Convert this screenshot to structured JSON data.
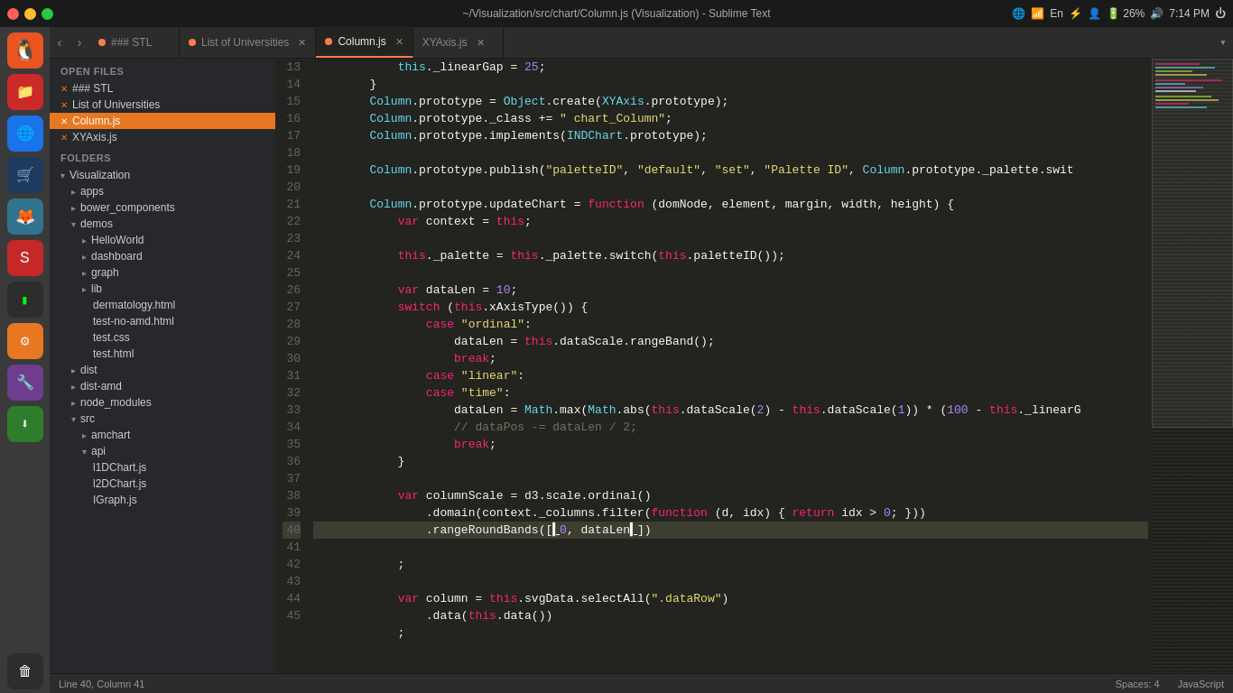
{
  "titlebar": {
    "title": "~/Visualization/src/chart/Column.js (Visualization) - Sublime Text",
    "systray": {
      "time": "7:14 PM",
      "battery": "26%",
      "lang": "En"
    }
  },
  "tabs": [
    {
      "id": "stl",
      "label": "### STL",
      "dot_color": "orange",
      "active": false,
      "closable": false
    },
    {
      "id": "universities",
      "label": "List of Universities",
      "dot_color": "orange",
      "active": false,
      "closable": true
    },
    {
      "id": "column",
      "label": "Column.js",
      "dot_color": "orange",
      "active": true,
      "closable": true
    },
    {
      "id": "xyaxis",
      "label": "XYAxis.js",
      "dot_color": "none",
      "active": false,
      "closable": true
    }
  ],
  "sidebar": {
    "open_files_title": "OPEN FILES",
    "open_files": [
      {
        "label": "### STL",
        "active": false,
        "marked": true
      },
      {
        "label": "List of Universities",
        "active": false,
        "marked": true
      },
      {
        "label": "Column.js",
        "active": true,
        "marked": true
      },
      {
        "label": "XYAxis.js",
        "active": false,
        "marked": true
      }
    ],
    "folders_title": "FOLDERS",
    "folders": [
      {
        "label": "Visualization",
        "level": 0,
        "expanded": true,
        "type": "folder"
      },
      {
        "label": "apps",
        "level": 1,
        "expanded": false,
        "type": "folder"
      },
      {
        "label": "bower_components",
        "level": 1,
        "expanded": false,
        "type": "folder"
      },
      {
        "label": "demos",
        "level": 1,
        "expanded": true,
        "type": "folder"
      },
      {
        "label": "HelloWorld",
        "level": 2,
        "expanded": false,
        "type": "folder"
      },
      {
        "label": "dashboard",
        "level": 2,
        "expanded": false,
        "type": "folder"
      },
      {
        "label": "graph",
        "level": 2,
        "expanded": false,
        "type": "folder"
      },
      {
        "label": "lib",
        "level": 2,
        "expanded": false,
        "type": "folder"
      },
      {
        "label": "dermatology.html",
        "level": 3,
        "type": "file"
      },
      {
        "label": "test-no-amd.html",
        "level": 3,
        "type": "file"
      },
      {
        "label": "test.css",
        "level": 3,
        "type": "file"
      },
      {
        "label": "test.html",
        "level": 3,
        "type": "file"
      },
      {
        "label": "dist",
        "level": 1,
        "expanded": false,
        "type": "folder"
      },
      {
        "label": "dist-amd",
        "level": 1,
        "expanded": false,
        "type": "folder"
      },
      {
        "label": "node_modules",
        "level": 1,
        "expanded": false,
        "type": "folder"
      },
      {
        "label": "src",
        "level": 1,
        "expanded": true,
        "type": "folder"
      },
      {
        "label": "amchart",
        "level": 2,
        "expanded": false,
        "type": "folder"
      },
      {
        "label": "api",
        "level": 2,
        "expanded": true,
        "type": "folder"
      },
      {
        "label": "l1DChart.js",
        "level": 3,
        "type": "file"
      },
      {
        "label": "l2DChart.js",
        "level": 3,
        "type": "file"
      },
      {
        "label": "IGraph.js",
        "level": 3,
        "type": "file"
      }
    ]
  },
  "editor": {
    "lines": [
      {
        "num": 13,
        "code": "            this._linearGap = 25;"
      },
      {
        "num": 14,
        "code": "        }"
      },
      {
        "num": 15,
        "code": "        Column.prototype = Object.create(XYAxis.prototype);"
      },
      {
        "num": 16,
        "code": "        Column.prototype._class += \" chart_Column\";"
      },
      {
        "num": 17,
        "code": "        Column.prototype.implements(INDChart.prototype);"
      },
      {
        "num": 18,
        "code": ""
      },
      {
        "num": 19,
        "code": "        Column.prototype.publish(\"paletteID\", \"default\", \"set\", \"Palette ID\", Column.prototype._palette.swit"
      },
      {
        "num": 20,
        "code": ""
      },
      {
        "num": 21,
        "code": "        Column.prototype.updateChart = function (domNode, element, margin, width, height) {"
      },
      {
        "num": 22,
        "code": "            var context = this;"
      },
      {
        "num": 23,
        "code": ""
      },
      {
        "num": 24,
        "code": "            this._palette = this._palette.switch(this.paletteID());"
      },
      {
        "num": 25,
        "code": ""
      },
      {
        "num": 26,
        "code": "            var dataLen = 10;"
      },
      {
        "num": 27,
        "code": "            switch (this.xAxisType()) {"
      },
      {
        "num": 28,
        "code": "                case \"ordinal\":"
      },
      {
        "num": 29,
        "code": "                    dataLen = this.dataScale.rangeBand();"
      },
      {
        "num": 30,
        "code": "                    break;"
      },
      {
        "num": 31,
        "code": "                case \"linear\":"
      },
      {
        "num": 32,
        "code": "                case \"time\":"
      },
      {
        "num": 33,
        "code": "                    dataLen = Math.max(Math.abs(this.dataScale(2) - this.dataScale(1)) * (100 - this._linearG"
      },
      {
        "num": 34,
        "code": "                    // dataPos -= dataLen / 2;"
      },
      {
        "num": 35,
        "code": "                    break;"
      },
      {
        "num": 36,
        "code": "            }"
      },
      {
        "num": 37,
        "code": ""
      },
      {
        "num": 38,
        "code": "            var columnScale = d3.scale.ordinal()"
      },
      {
        "num": 39,
        "code": "                .domain(context._columns.filter(function (d, idx) { return idx > 0; }))"
      },
      {
        "num": 40,
        "code": "                .rangeRoundBands([0, dataLen])",
        "highlight": true
      },
      {
        "num": 41,
        "code": "            ;"
      },
      {
        "num": 42,
        "code": ""
      },
      {
        "num": 43,
        "code": "            var column = this.svgData.selectAll(\".dataRow\")"
      },
      {
        "num": 44,
        "code": "                .data(this.data())"
      },
      {
        "num": 45,
        "code": "            ;"
      }
    ]
  },
  "statusbar": {
    "left": "Line 40, Column 41",
    "spaces": "Spaces: 4",
    "language": "JavaScript"
  }
}
